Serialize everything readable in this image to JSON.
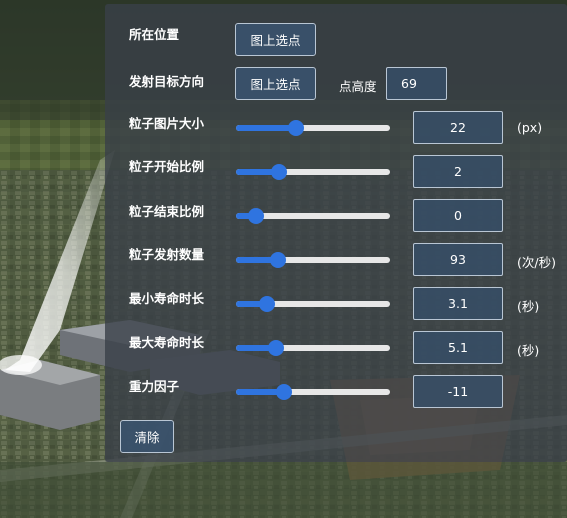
{
  "panel": {
    "location_label": "所在位置",
    "location_button": "图上选点",
    "direction_label": "发射目标方向",
    "direction_button": "图上选点",
    "height_label": "点高度",
    "height_value": "69",
    "clear_button": "清除"
  },
  "sliders": [
    {
      "label": "粒子图片大小",
      "value": "22",
      "unit": "(px)",
      "level": 0.39
    },
    {
      "label": "粒子开始比例",
      "value": "2",
      "unit": "",
      "level": 0.28
    },
    {
      "label": "粒子结束比例",
      "value": "0",
      "unit": "",
      "level": 0.13
    },
    {
      "label": "粒子发射数量",
      "value": "93",
      "unit": "(次/秒)",
      "level": 0.27
    },
    {
      "label": "最小寿命时长",
      "value": "3.1",
      "unit": "(秒)",
      "level": 0.2
    },
    {
      "label": "最大寿命时长",
      "value": "5.1",
      "unit": "(秒)",
      "level": 0.26
    },
    {
      "label": "重力因子",
      "value": "-11",
      "unit": "",
      "level": 0.31
    }
  ],
  "colors": {
    "accent": "#2f74e0",
    "panel_bg": "#3a4048",
    "button_bg": "#3a5470"
  }
}
